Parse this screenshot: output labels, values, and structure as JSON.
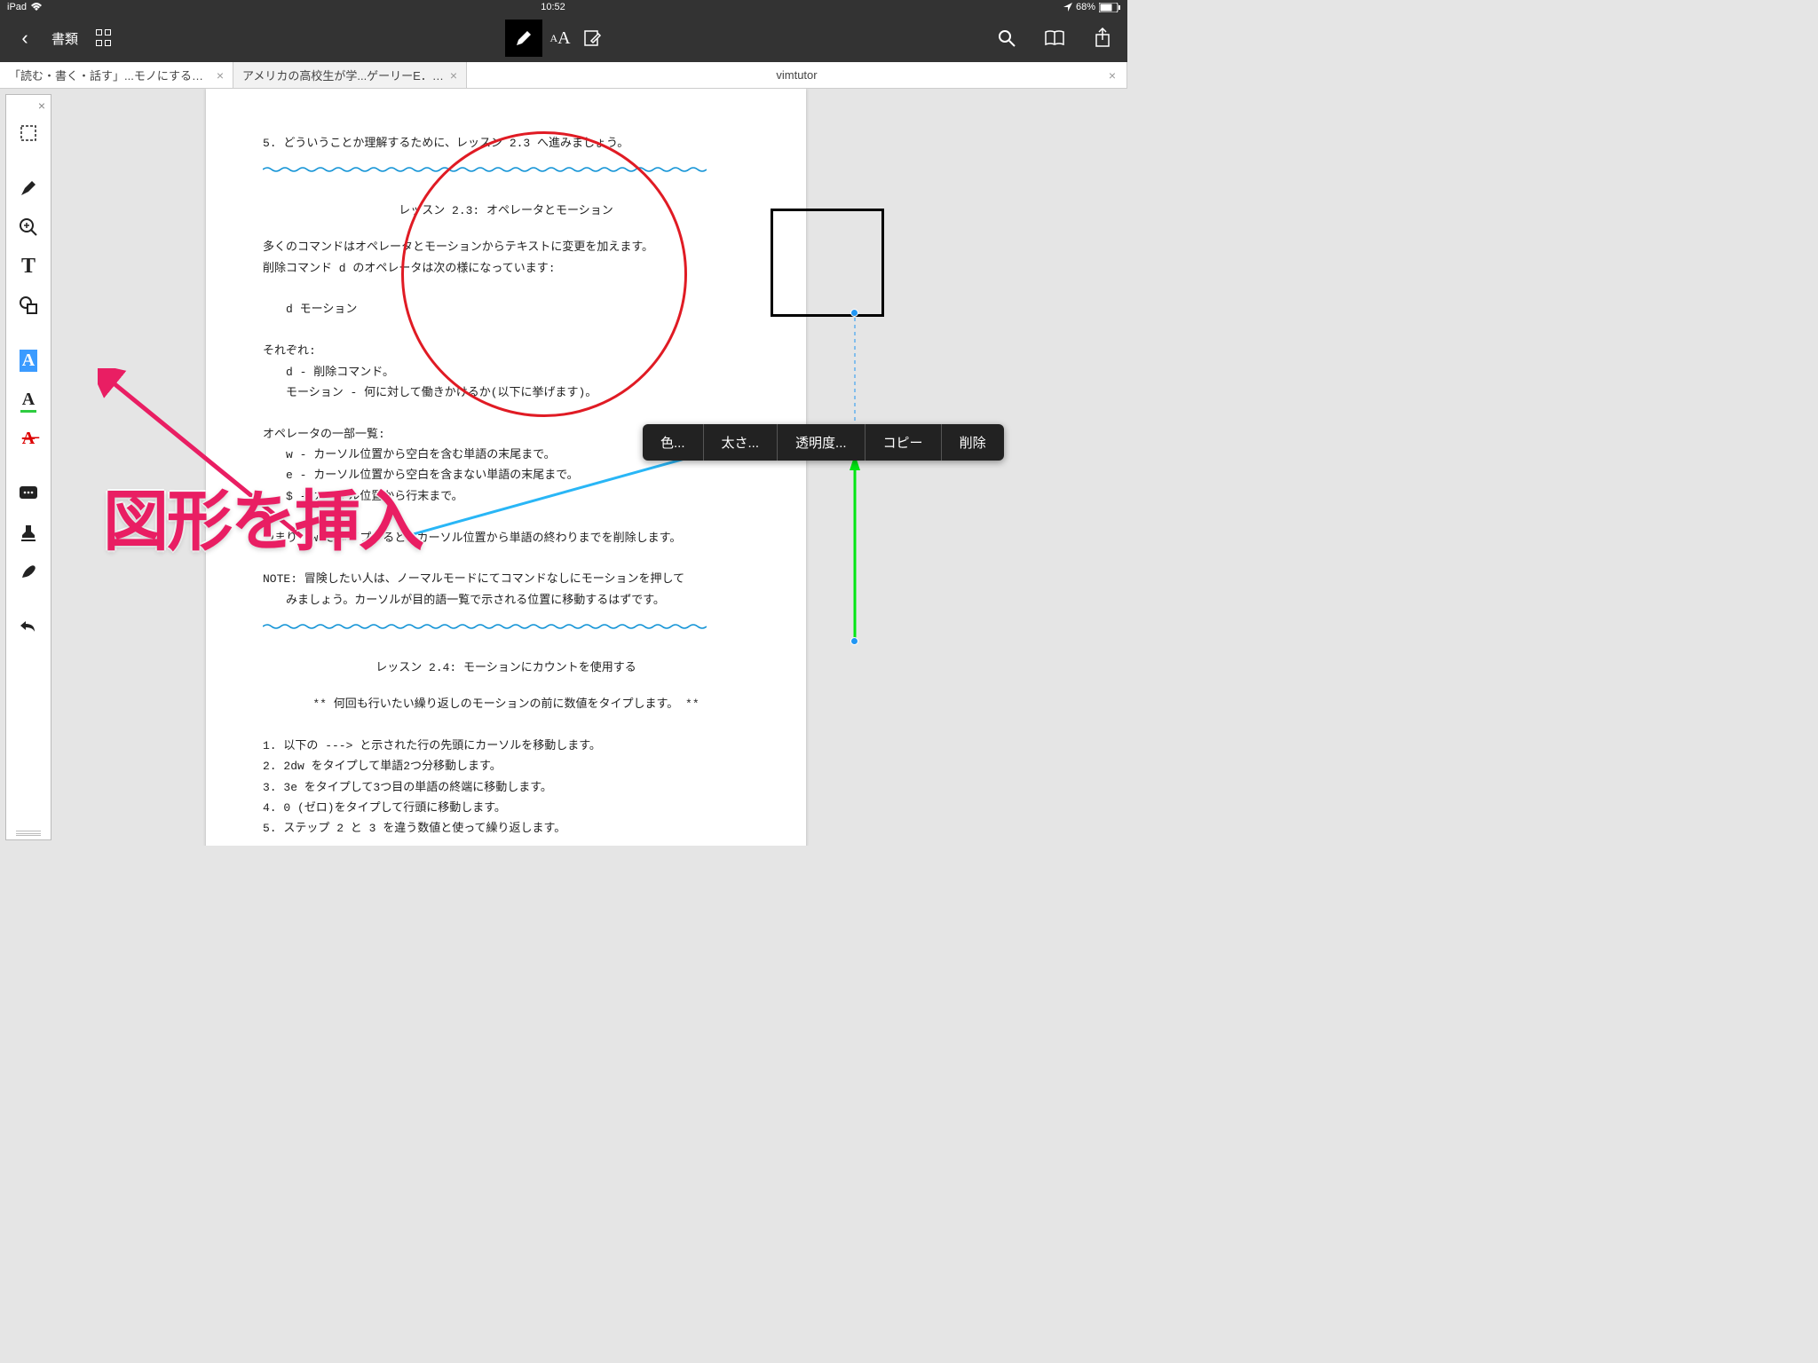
{
  "status": {
    "device": "iPad",
    "time": "10:52",
    "battery": "68%"
  },
  "toolbar": {
    "docs_label": "書類"
  },
  "tabs": [
    {
      "title": "「読む・書く・話す」...モノにする技術 齋藤 孝"
    },
    {
      "title": "アメリカの高校生が学...ゲーリーE．クレイトン"
    },
    {
      "title": "vimtutor"
    }
  ],
  "context_menu": {
    "color": "色...",
    "thickness": "太さ...",
    "opacity": "透明度...",
    "copy": "コピー",
    "delete": "削除"
  },
  "overlay_text": "図形を挿入",
  "doc": {
    "l1": "5. どういうことか理解するために、レッスン 2.3 へ進みましょう。",
    "t23": "レッスン 2.3: オペレータとモーション",
    "p23a": "多くのコマンドはオペレータとモーションからテキストに変更を加えます。",
    "p23b": "削除コマンド d のオペレータは次の様になっています:",
    "dm": "d   モーション",
    "sore": "それぞれ:",
    "dline": "d         - 削除コマンド。",
    "mline": "モーション - 何に対して働きかけるか(以下に挙げます)。",
    "oplist": "オペレータの一部一覧:",
    "w": "w - カーソル位置から空白を含む単語の末尾まで。",
    "e": "e - カーソル位置から空白を含まない単語の末尾まで。",
    "dollar": "$ - カーソル位置から行末まで。",
    "dw": "つまり dw とタイプすると、カーソル位置から単語の終わりまでを削除します。",
    "note1": "NOTE: 冒険したい人は、ノーマルモードにてコマンドなしにモーションを押して",
    "note2": "みましょう。カーソルが目的語一覧で示される位置に移動するはずです。",
    "t24": "レッスン 2.4: モーションにカウントを使用する",
    "p24": "** 何回も行いたい繰り返しのモーションの前に数値をタイプします。 **",
    "s1": "1. 以下の ---> と示された行の先頭にカーソルを移動します。",
    "s2": "2. 2dw をタイプして単語2つ分移動します。",
    "s3": "3. 3e をタイプして3つ目の単語の終端に移動します。",
    "s4": "4. 0 (ゼロ)をタイプして行頭に移動します。",
    "s5": "5. ステップ 2 と 3 を違う数値と使って繰り返します。"
  }
}
